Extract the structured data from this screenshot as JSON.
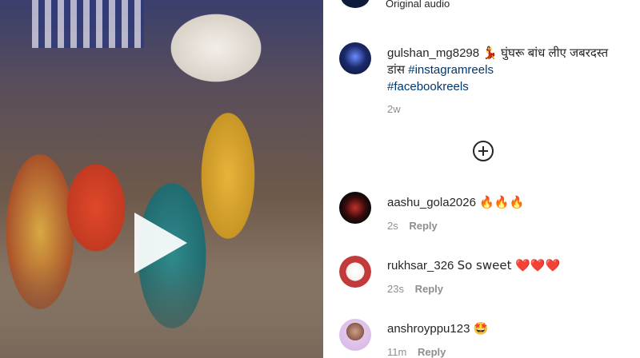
{
  "post": {
    "audio_label": "Original audio",
    "caption_user": "gulshan_mg8298",
    "caption_text": "💃 घुंघरू बांध लीए जबरदस्त डांस",
    "hashtag_1": "#instagramreels",
    "hashtag_2": "#facebookreels",
    "caption_time": "2w"
  },
  "comments": [
    {
      "user": "aashu_gola2026",
      "text": "🔥🔥🔥",
      "time": "2s",
      "reply_label": "Reply"
    },
    {
      "user": "rukhsar_326",
      "text": "So sweet ❤️❤️❤️",
      "time": "23s",
      "reply_label": "Reply"
    },
    {
      "user": "anshroyppu123",
      "text": "🤩",
      "time": "11m",
      "reply_label": "Reply"
    }
  ]
}
